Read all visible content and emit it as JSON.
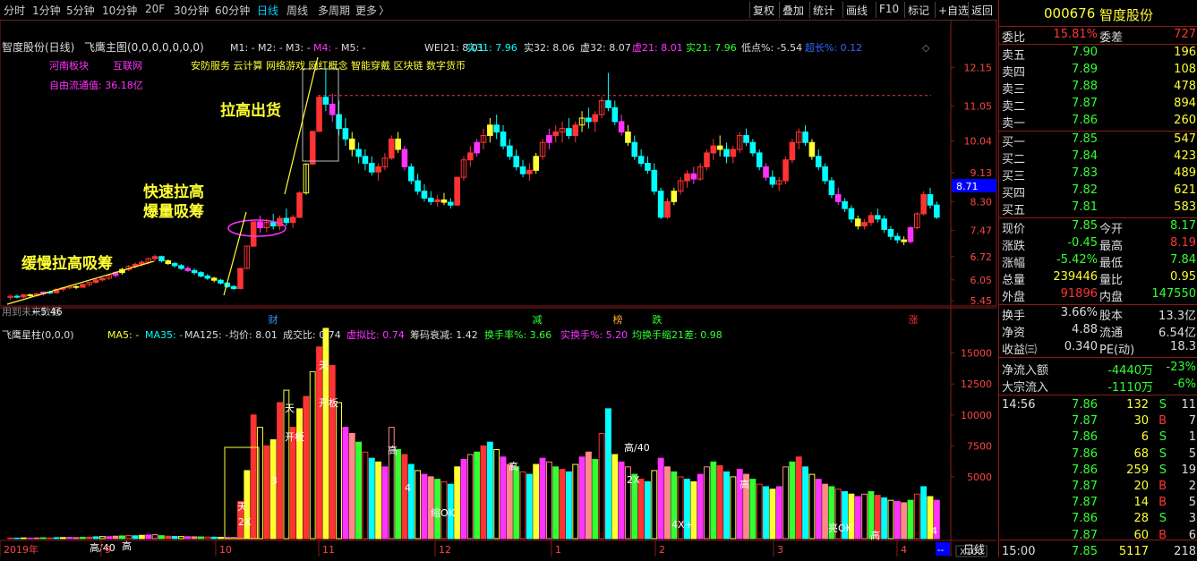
{
  "toolbar": {
    "left": [
      "分时",
      "1分钟",
      "5分钟",
      "10分钟",
      "20F",
      "30分钟",
      "60分钟",
      "日线",
      "周线",
      "多周期",
      "更多"
    ],
    "more_arrow": "〉",
    "right": [
      "复权",
      "叠加",
      "统计",
      "画线",
      "F10",
      "标记",
      "+自选",
      "返回"
    ],
    "active": "日线"
  },
  "main": {
    "title": "智度股份(日线)",
    "indicator": "飞鹰主图(0,0,0,0,0,0,0)",
    "ma": [
      "M1: -",
      "M2: -",
      "M3: -",
      "M4: -",
      "M5: -"
    ],
    "wei": "WEI21: 8.01",
    "shi31": "实31: 7.96",
    "shi32": "实32: 8.06",
    "xu32": "虚32: 8.07",
    "xu21": "虚21: 8.01",
    "shi21": "实21: 7.96",
    "didian": "低点%: -5.54",
    "chaozhang": "超长%: 0.12",
    "tags": [
      "河南板块",
      "互联网"
    ],
    "float_cap": "自由流通值: 36.18亿",
    "concepts": "安防服务 云计算 网络游戏 网红概念 智能穿戴 区块链 数字货币",
    "annot_slow": "缓慢拉高吸筹",
    "annot_fast1": "快速拉高",
    "annot_fast2": "爆量吸筹",
    "annot_top": "拉高出货",
    "low_label": "←5.46",
    "watermark": "用到未来数据",
    "last_price_box": "8.71",
    "events": [
      "财",
      "减",
      "榜",
      "跌",
      "涨"
    ],
    "price_ticks": [
      "12.15",
      "11.05",
      "10.04",
      "9.13",
      "8.30",
      "7.47",
      "6.72",
      "6.05",
      "5.45"
    ]
  },
  "vol": {
    "title": "飞鹰星柱(0,0,0)",
    "ma5": "MA5: -",
    "ma35": "MA35: -",
    "ma125": "MA125: -",
    "avg": "均价: 8.01",
    "deal_ratio": "成交比: 0.74",
    "xuni_ratio": "虚拟比: 0.74",
    "chip": "筹码衰减: 1.42",
    "turnover": "换手率%: 3.66",
    "real_turnover": "实换手%: 5.20",
    "avg_turn": "均换手缩21差: 0.98",
    "vol_ticks": [
      "15000",
      "12500",
      "10000",
      "7500",
      "5000"
    ],
    "unit": "X100",
    "bar_labels": [
      "天",
      "开板",
      "天",
      "开板",
      "高",
      "高/40",
      "高",
      "高",
      "2X",
      "天",
      "2X",
      "3",
      "4",
      "缩OK",
      "4X+",
      "亮OK",
      "高",
      "高/40",
      "高",
      "4"
    ]
  },
  "xaxis": {
    "labels": [
      "2019年",
      "9",
      "10",
      "11",
      "12",
      "1",
      "2",
      "3",
      "4"
    ],
    "period": "日线",
    "dash": "--"
  },
  "quote": {
    "code": "000676",
    "name": "智度股份",
    "weibi_label": "委比",
    "weibi": "15.81%",
    "weicha_label": "委差",
    "weicha": "727",
    "asks": [
      {
        "label": "卖五",
        "price": "7.90",
        "vol": "196"
      },
      {
        "label": "卖四",
        "price": "7.89",
        "vol": "108"
      },
      {
        "label": "卖三",
        "price": "7.88",
        "vol": "478"
      },
      {
        "label": "卖二",
        "price": "7.87",
        "vol": "894"
      },
      {
        "label": "卖一",
        "price": "7.86",
        "vol": "260"
      }
    ],
    "bids": [
      {
        "label": "买一",
        "price": "7.85",
        "vol": "547"
      },
      {
        "label": "买二",
        "price": "7.84",
        "vol": "423"
      },
      {
        "label": "买三",
        "price": "7.83",
        "vol": "489"
      },
      {
        "label": "买四",
        "price": "7.82",
        "vol": "621"
      },
      {
        "label": "买五",
        "price": "7.81",
        "vol": "583"
      }
    ],
    "stats": [
      {
        "l1": "现价",
        "v1": "7.85",
        "l2": "今开",
        "v2": "8.17"
      },
      {
        "l1": "涨跌",
        "v1": "-0.45",
        "l2": "最高",
        "v2": "8.19"
      },
      {
        "l1": "涨幅",
        "v1": "-5.42%",
        "l2": "最低",
        "v2": "7.84"
      },
      {
        "l1": "总量",
        "v1": "239446",
        "l2": "量比",
        "v2": "0.95"
      },
      {
        "l1": "外盘",
        "v1": "91896",
        "l2": "内盘",
        "v2": "147550"
      }
    ],
    "fund": [
      {
        "l1": "换手",
        "v1": "3.66%",
        "l2": "股本",
        "v2": "13.3亿"
      },
      {
        "l1": "净资",
        "v1": "4.88",
        "l2": "流通",
        "v2": "6.54亿"
      },
      {
        "l1": "收益㈢",
        "v1": "0.340",
        "l2": "PE(动)",
        "v2": "18.3"
      }
    ],
    "flow": [
      {
        "l": "净流入额",
        "v": "-4440万",
        "p": "-23%"
      },
      {
        "l": "大宗流入",
        "v": "-1110万",
        "p": "-6%"
      }
    ],
    "ticks": [
      {
        "t": "14:56",
        "p": "7.86",
        "v": "132",
        "s": "S",
        "n": "11"
      },
      {
        "t": "",
        "p": "7.87",
        "v": "30",
        "s": "B",
        "n": "7"
      },
      {
        "t": "",
        "p": "7.86",
        "v": "6",
        "s": "S",
        "n": "1"
      },
      {
        "t": "",
        "p": "7.86",
        "v": "68",
        "s": "S",
        "n": "5"
      },
      {
        "t": "",
        "p": "7.86",
        "v": "259",
        "s": "S",
        "n": "19"
      },
      {
        "t": "",
        "p": "7.87",
        "v": "20",
        "s": "B",
        "n": "2"
      },
      {
        "t": "",
        "p": "7.87",
        "v": "14",
        "s": "B",
        "n": "5"
      },
      {
        "t": "",
        "p": "7.86",
        "v": "28",
        "s": "S",
        "n": "3"
      },
      {
        "t": "",
        "p": "7.87",
        "v": "60",
        "s": "B",
        "n": "6"
      },
      {
        "t": "15:00",
        "p": "7.85",
        "v": "5117",
        "s": "",
        "n": "218"
      }
    ]
  },
  "chart_data": {
    "type": "candlestick",
    "title": "智度股份(日线)",
    "price_range": [
      5.3,
      12.5
    ],
    "volume_range": [
      0,
      17000
    ],
    "candles": [
      [
        5.55,
        5.62,
        5.48,
        5.58
      ],
      [
        5.58,
        5.62,
        5.52,
        5.56
      ],
      [
        5.56,
        5.65,
        5.52,
        5.62
      ],
      [
        5.62,
        5.66,
        5.56,
        5.6
      ],
      [
        5.6,
        5.68,
        5.57,
        5.65
      ],
      [
        5.65,
        5.72,
        5.6,
        5.7
      ],
      [
        5.7,
        5.74,
        5.64,
        5.68
      ],
      [
        5.68,
        5.8,
        5.66,
        5.78
      ],
      [
        5.78,
        5.84,
        5.72,
        5.82
      ],
      [
        5.82,
        5.9,
        5.78,
        5.86
      ],
      [
        5.86,
        5.9,
        5.78,
        5.84
      ],
      [
        5.84,
        5.95,
        5.82,
        5.92
      ],
      [
        5.92,
        6.0,
        5.86,
        5.98
      ],
      [
        5.98,
        6.08,
        5.94,
        6.05
      ],
      [
        6.05,
        6.12,
        6.0,
        6.1
      ],
      [
        6.1,
        6.2,
        6.05,
        6.18
      ],
      [
        6.18,
        6.3,
        6.12,
        6.26
      ],
      [
        6.26,
        6.4,
        6.2,
        6.35
      ],
      [
        6.35,
        6.48,
        6.3,
        6.44
      ],
      [
        6.44,
        6.55,
        6.38,
        6.5
      ],
      [
        6.5,
        6.62,
        6.44,
        6.56
      ],
      [
        6.56,
        6.7,
        6.5,
        6.66
      ],
      [
        6.66,
        6.78,
        6.58,
        6.72
      ],
      [
        6.72,
        6.75,
        6.55,
        6.6
      ],
      [
        6.6,
        6.64,
        6.48,
        6.52
      ],
      [
        6.52,
        6.56,
        6.4,
        6.46
      ],
      [
        6.46,
        6.5,
        6.34,
        6.38
      ],
      [
        6.38,
        6.44,
        6.28,
        6.32
      ],
      [
        6.32,
        6.38,
        6.2,
        6.26
      ],
      [
        6.26,
        6.3,
        6.12,
        6.16
      ],
      [
        6.16,
        6.22,
        6.05,
        6.1
      ],
      [
        6.1,
        6.14,
        5.98,
        6.04
      ],
      [
        6.04,
        6.08,
        5.92,
        5.96
      ],
      [
        5.96,
        6.0,
        5.82,
        5.86
      ],
      [
        5.86,
        5.9,
        5.76,
        5.8
      ],
      [
        5.8,
        6.4,
        5.78,
        6.38
      ],
      [
        6.38,
        7.02,
        6.36,
        7.02
      ],
      [
        7.02,
        7.72,
        7.0,
        7.72
      ],
      [
        7.72,
        7.9,
        7.4,
        7.55
      ],
      [
        7.55,
        7.8,
        7.42,
        7.7
      ],
      [
        7.7,
        7.95,
        7.5,
        7.6
      ],
      [
        7.6,
        7.9,
        7.48,
        7.82
      ],
      [
        7.82,
        8.1,
        7.6,
        7.7
      ],
      [
        7.7,
        7.92,
        7.55,
        7.85
      ],
      [
        7.85,
        8.6,
        7.82,
        8.55
      ],
      [
        8.55,
        9.4,
        8.5,
        9.38
      ],
      [
        9.38,
        10.32,
        9.35,
        10.32
      ],
      [
        10.32,
        11.35,
        10.3,
        11.3
      ],
      [
        11.3,
        12.1,
        10.9,
        11.1
      ],
      [
        11.1,
        11.4,
        10.6,
        10.8
      ],
      [
        10.8,
        11.2,
        10.2,
        10.4
      ],
      [
        10.4,
        10.7,
        9.9,
        10.1
      ],
      [
        10.1,
        10.3,
        9.6,
        9.8
      ],
      [
        9.8,
        10.0,
        9.4,
        9.6
      ],
      [
        9.6,
        9.8,
        9.2,
        9.4
      ],
      [
        9.4,
        9.6,
        9.05,
        9.15
      ],
      [
        9.15,
        9.4,
        8.9,
        9.3
      ],
      [
        9.3,
        9.7,
        9.2,
        9.55
      ],
      [
        9.55,
        10.2,
        9.5,
        10.1
      ],
      [
        10.1,
        10.3,
        9.7,
        9.8
      ],
      [
        9.8,
        9.9,
        9.2,
        9.3
      ],
      [
        9.3,
        9.4,
        8.8,
        8.9
      ],
      [
        8.9,
        9.1,
        8.5,
        8.6
      ],
      [
        8.6,
        8.8,
        8.3,
        8.4
      ],
      [
        8.4,
        8.6,
        8.2,
        8.3
      ],
      [
        8.3,
        8.5,
        8.15,
        8.35
      ],
      [
        8.35,
        8.55,
        8.2,
        8.28
      ],
      [
        8.28,
        8.4,
        8.1,
        8.2
      ],
      [
        8.2,
        9.0,
        8.18,
        9.0
      ],
      [
        9.0,
        9.6,
        8.9,
        9.5
      ],
      [
        9.5,
        9.9,
        9.3,
        9.7
      ],
      [
        9.7,
        10.1,
        9.6,
        10.0
      ],
      [
        10.0,
        10.4,
        9.8,
        10.2
      ],
      [
        10.2,
        10.7,
        10.0,
        10.5
      ],
      [
        10.5,
        10.8,
        10.1,
        10.3
      ],
      [
        10.3,
        10.5,
        9.8,
        9.9
      ],
      [
        9.9,
        10.1,
        9.5,
        9.6
      ],
      [
        9.6,
        9.8,
        9.2,
        9.3
      ],
      [
        9.3,
        9.5,
        9.0,
        9.1
      ],
      [
        9.1,
        9.4,
        8.9,
        9.2
      ],
      [
        9.2,
        9.7,
        9.1,
        9.6
      ],
      [
        9.6,
        10.1,
        9.5,
        10.0
      ],
      [
        10.0,
        10.4,
        9.8,
        10.2
      ],
      [
        10.2,
        10.5,
        10.0,
        10.3
      ],
      [
        10.3,
        10.6,
        10.0,
        10.4
      ],
      [
        10.4,
        10.7,
        10.1,
        10.2
      ],
      [
        10.2,
        10.6,
        10.0,
        10.5
      ],
      [
        10.5,
        10.9,
        10.3,
        10.7
      ],
      [
        10.7,
        11.0,
        10.4,
        10.6
      ],
      [
        10.6,
        10.9,
        10.3,
        10.8
      ],
      [
        10.8,
        11.3,
        10.7,
        11.2
      ],
      [
        11.2,
        12.0,
        10.9,
        11.0
      ],
      [
        11.0,
        11.2,
        10.5,
        10.6
      ],
      [
        10.6,
        10.8,
        10.2,
        10.3
      ],
      [
        10.3,
        10.5,
        9.9,
        10.0
      ],
      [
        10.0,
        10.2,
        9.5,
        9.6
      ],
      [
        9.6,
        9.8,
        9.3,
        9.4
      ],
      [
        9.4,
        9.6,
        9.1,
        9.2
      ],
      [
        9.2,
        9.4,
        8.5,
        8.6
      ],
      [
        8.6,
        8.7,
        7.8,
        7.85
      ],
      [
        7.85,
        8.4,
        7.8,
        8.3
      ],
      [
        8.3,
        8.7,
        8.2,
        8.6
      ],
      [
        8.6,
        9.0,
        8.5,
        8.9
      ],
      [
        8.9,
        9.2,
        8.7,
        9.1
      ],
      [
        9.1,
        9.3,
        8.8,
        8.95
      ],
      [
        8.95,
        9.4,
        8.9,
        9.3
      ],
      [
        9.3,
        9.8,
        9.2,
        9.7
      ],
      [
        9.7,
        10.1,
        9.5,
        9.9
      ],
      [
        9.9,
        10.2,
        9.6,
        9.8
      ],
      [
        9.8,
        10.0,
        9.4,
        9.6
      ],
      [
        9.6,
        9.9,
        9.4,
        9.8
      ],
      [
        9.8,
        10.3,
        9.7,
        10.2
      ],
      [
        10.2,
        10.4,
        9.9,
        10.0
      ],
      [
        10.0,
        10.1,
        9.6,
        9.7
      ],
      [
        9.7,
        9.8,
        9.2,
        9.3
      ],
      [
        9.3,
        9.4,
        8.9,
        9.0
      ],
      [
        9.0,
        9.2,
        8.7,
        8.8
      ],
      [
        8.8,
        9.0,
        8.6,
        8.9
      ],
      [
        8.9,
        9.6,
        8.8,
        9.5
      ],
      [
        9.5,
        10.1,
        9.4,
        10.0
      ],
      [
        10.0,
        10.4,
        9.8,
        10.3
      ],
      [
        10.3,
        10.5,
        9.9,
        10.0
      ],
      [
        10.0,
        10.1,
        9.5,
        9.6
      ],
      [
        9.6,
        9.8,
        9.2,
        9.3
      ],
      [
        9.3,
        9.4,
        8.8,
        8.9
      ],
      [
        8.9,
        9.0,
        8.4,
        8.5
      ],
      [
        8.5,
        8.7,
        8.2,
        8.3
      ],
      [
        8.3,
        8.4,
        8.0,
        8.1
      ],
      [
        8.1,
        8.2,
        7.7,
        7.8
      ],
      [
        7.8,
        7.9,
        7.5,
        7.6
      ],
      [
        7.6,
        7.8,
        7.5,
        7.7
      ],
      [
        7.7,
        8.0,
        7.6,
        7.9
      ],
      [
        7.9,
        8.1,
        7.7,
        7.8
      ],
      [
        7.8,
        7.9,
        7.4,
        7.5
      ],
      [
        7.5,
        7.6,
        7.2,
        7.3
      ],
      [
        7.3,
        7.4,
        7.1,
        7.2
      ],
      [
        7.2,
        7.3,
        7.05,
        7.15
      ],
      [
        7.15,
        7.6,
        7.1,
        7.55
      ],
      [
        7.55,
        8.0,
        7.5,
        7.95
      ],
      [
        7.95,
        8.6,
        7.9,
        8.5
      ],
      [
        8.5,
        8.7,
        8.1,
        8.2
      ],
      [
        8.2,
        8.3,
        7.8,
        7.85
      ]
    ],
    "volumes": [
      50,
      40,
      60,
      45,
      55,
      70,
      50,
      80,
      90,
      100,
      80,
      110,
      120,
      150,
      170,
      160,
      200,
      220,
      250,
      230,
      270,
      300,
      320,
      240,
      200,
      180,
      170,
      160,
      150,
      140,
      130,
      120,
      110,
      100,
      90,
      3000,
      5500,
      10000,
      9000,
      7500,
      8000,
      11000,
      12000,
      9000,
      10500,
      11500,
      13500,
      15500,
      17000,
      14000,
      11000,
      9000,
      8500,
      7800,
      7000,
      6500,
      6200,
      5800,
      9000,
      7200,
      6800,
      6000,
      5500,
      5200,
      5000,
      4800,
      4600,
      4400,
      5800,
      6400,
      6800,
      7000,
      7500,
      7800,
      7200,
      6600,
      6000,
      5800,
      5400,
      5200,
      6000,
      6500,
      6200,
      5800,
      5600,
      5400,
      6000,
      6600,
      7000,
      6400,
      8500,
      10500,
      6800,
      6200,
      5800,
      5200,
      4800,
      4600,
      5500,
      6500,
      5800,
      5400,
      5000,
      4800,
      4600,
      5200,
      5800,
      6200,
      5900,
      5400,
      5000,
      5600,
      5200,
      4800,
      4400,
      4200,
      4000,
      4200,
      5800,
      6200,
      6600,
      5800,
      5200,
      4800,
      4400,
      4200,
      4000,
      3800,
      3600,
      3400,
      3600,
      3800,
      3500,
      3300,
      3100,
      3000,
      2900,
      3100,
      3600,
      4200,
      3400,
      3100
    ]
  }
}
